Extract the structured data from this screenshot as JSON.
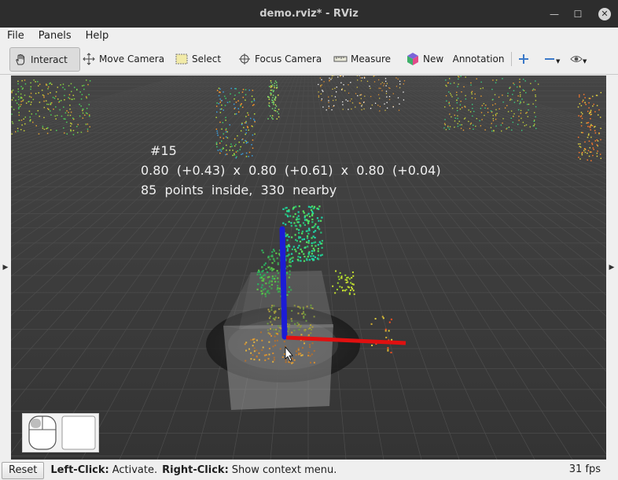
{
  "window": {
    "title": "demo.rviz* - RViz",
    "min_glyph": "—",
    "max_glyph": "☐",
    "close_glyph": "✕"
  },
  "menu": {
    "items": [
      "File",
      "Panels",
      "Help"
    ]
  },
  "toolbar": {
    "interact": "Interact",
    "move_camera": "Move Camera",
    "select": "Select",
    "focus_camera": "Focus Camera",
    "measure": "Measure",
    "new_annotation": "New   Annotation"
  },
  "overlay": {
    "id": "#15",
    "dims": "0.80  (+0.43)  x  0.80  (+0.61)  x  0.80  (+0.04)",
    "points": "85  points  inside,  330  nearby"
  },
  "status": {
    "reset": "Reset",
    "left_click_label": "Left-Click:",
    "left_click_text": "Activate.",
    "right_click_label": "Right-Click:",
    "right_click_text": "Show context menu.",
    "fps": "31 fps"
  },
  "icons": [
    "hand-icon",
    "move-camera-icon",
    "select-icon",
    "focus-camera-icon",
    "measure-icon",
    "cube-icon",
    "plus-icon",
    "minus-icon",
    "eye-icon",
    "mouse-icon"
  ],
  "colors": {
    "grid_bg": "#3b3b3b",
    "axis_z": "#1c1cd6",
    "axis_x": "#e01010"
  }
}
